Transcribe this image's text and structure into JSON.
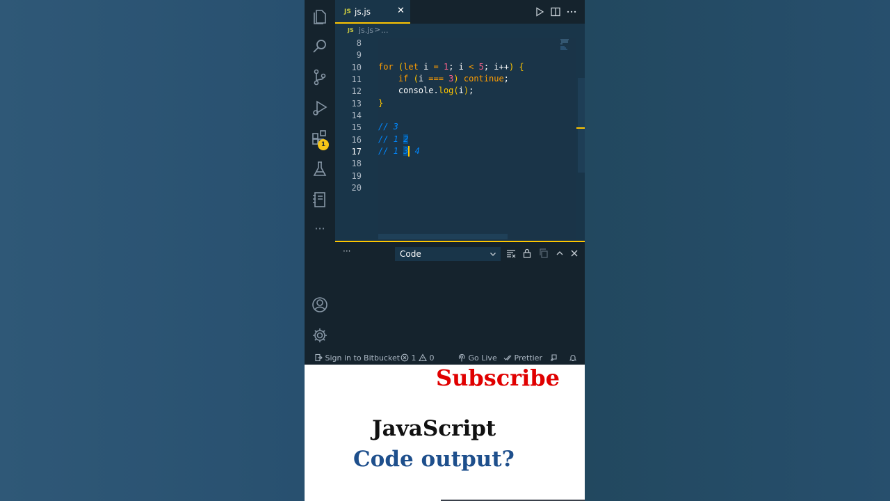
{
  "tab": {
    "icon_label": "JS",
    "filename": "js.js",
    "close_glyph": "✕"
  },
  "breadcrumb": {
    "icon_label": "JS",
    "file": "js.js",
    "separator": ">",
    "more": "..."
  },
  "activity_bar": {
    "items": [
      "explorer-icon",
      "search-icon",
      "source-control-icon",
      "run-debug-icon",
      "extensions-icon",
      "testing-icon",
      "notebook-icon",
      "more-icon"
    ],
    "more_label": "···",
    "extensions_badge": "1",
    "bottom_items": [
      "accounts-icon",
      "settings-gear-icon"
    ]
  },
  "editor_actions": [
    "run-icon",
    "split-editor-icon",
    "more-actions-icon"
  ],
  "line_numbers": [
    "8",
    "9",
    "10",
    "11",
    "12",
    "13",
    "14",
    "15",
    "16",
    "17",
    "18",
    "19",
    "20"
  ],
  "code": {
    "l10": {
      "for": "for",
      "paren": "(",
      "let": "let",
      "i1": " i ",
      "eq": "=",
      "one": " 1",
      "semi1": "; i ",
      "lt": "<",
      "five": " 5",
      "semi2": "; ",
      "inc": "i++",
      "close": ")",
      "brace": " {"
    },
    "l11": {
      "indent": "    ",
      "if": "if",
      "open": " (",
      "i": "i",
      "eqq": " === ",
      "three": "3",
      "close": ")",
      "cont": " continue",
      "semi": ";"
    },
    "l12": {
      "indent": "    ",
      "obj": "console",
      "dot": ".",
      "fn": "log",
      "open": "(",
      "arg": "i",
      "close": ")",
      "semi": ";"
    },
    "l13": {
      "brace": "}"
    },
    "l15": "// 3",
    "l16": {
      "prefix": "// 1 ",
      "sel": "2"
    },
    "l17": {
      "prefix": "// 1 ",
      "sel": "3",
      "rest": " 4"
    }
  },
  "panel": {
    "more": "···",
    "dropdown_value": "Code",
    "icons": [
      "clear-output-icon",
      "lock-icon",
      "copy-icon",
      "chevron-up-icon",
      "close-icon"
    ]
  },
  "status_bar": {
    "bitbucket": "Sign in to Bitbucket",
    "errors": "1",
    "warnings": "0",
    "go_live": "Go Live",
    "prettier": "Prettier"
  },
  "overlay": {
    "subscribe": "Subscribe",
    "title": "JavaScript",
    "subtitle": "Code output?"
  },
  "colors": {
    "accent": "#ffc600",
    "editor_bg": "#193549",
    "subscribe_red": "#e00000",
    "subtitle_blue": "#1e4f8c"
  }
}
